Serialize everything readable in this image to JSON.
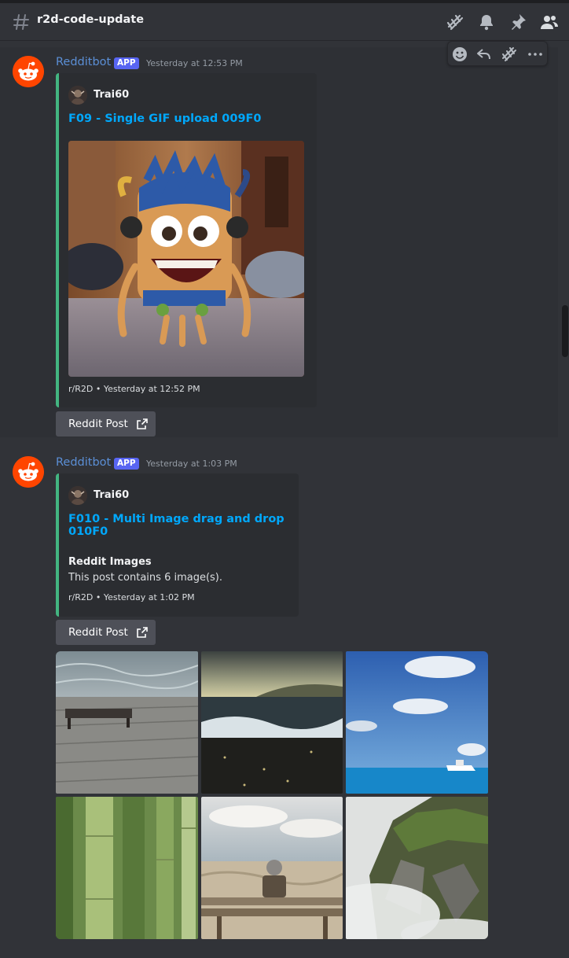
{
  "channel": {
    "name": "r2d-code-update"
  },
  "header_icons": [
    "threads-icon",
    "bell-icon",
    "pin-icon",
    "members-icon"
  ],
  "hover_toolbar": [
    "add-reaction-icon",
    "reply-icon",
    "create-thread-icon",
    "more-icon"
  ],
  "messages": [
    {
      "author": "Redditbot",
      "badge": "APP",
      "timestamp": "Yesterday at 12:53 PM",
      "embed": {
        "author": "Trai60",
        "title": "F09 - Single GIF upload 009F0",
        "image": "cartoon-monster-gif",
        "footer": "r/R2D • Yesterday at 12:52 PM"
      },
      "button": "Reddit Post"
    },
    {
      "author": "Redditbot",
      "badge": "APP",
      "timestamp": "Yesterday at 1:03 PM",
      "embed": {
        "author": "Trai60",
        "title": "F010 - Multi Image drag and drop 010F0",
        "field_name": "Reddit Images",
        "field_value": "This post contains 6 image(s).",
        "footer": "r/R2D • Yesterday at 1:02 PM"
      },
      "button": "Reddit Post",
      "gallery": [
        "pier-bench",
        "beach-waves",
        "blue-sky-boat",
        "bamboo",
        "man-on-bench",
        "foggy-cliff"
      ]
    }
  ],
  "colors": {
    "background": "#313338",
    "embed_accent": "#43b581",
    "link": "#00a8fc",
    "author": "#5b8fd6",
    "badge": "#5865f2",
    "reddit": "#ff4500"
  }
}
